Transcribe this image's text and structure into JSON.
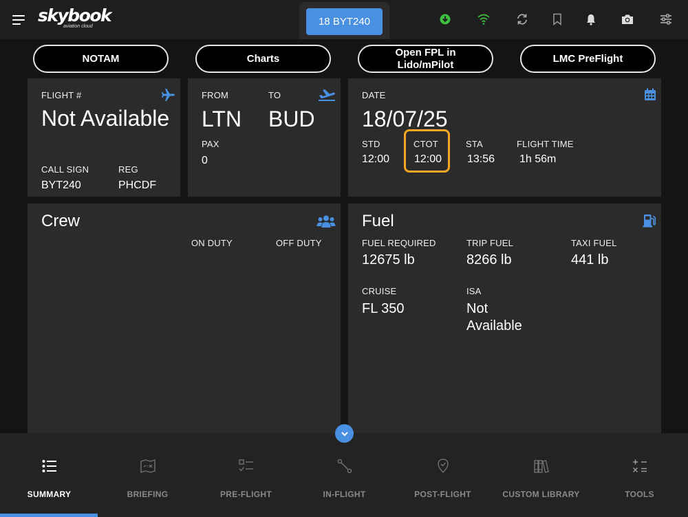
{
  "app": {
    "logo": "skybook",
    "logo_sub": "aviation cloud"
  },
  "header": {
    "flight_button": "18 BYT240",
    "icons": [
      "download-icon",
      "wifi-icon",
      "sync-icon",
      "bookmark-icon",
      "bell-icon",
      "camera-icon",
      "settings-sliders-icon"
    ]
  },
  "actions": {
    "notam": "NOTAM",
    "charts": "Charts",
    "open_fpl": "Open FPL in Lido/mPilot",
    "lmc": "LMC PreFlight"
  },
  "flight": {
    "label": "FLIGHT #",
    "value": "Not Available",
    "callsign_label": "CALL SIGN",
    "callsign": "BYT240",
    "reg_label": "REG",
    "reg": "PHCDF"
  },
  "route": {
    "from_label": "FROM",
    "from": "LTN",
    "to_label": "TO",
    "to": "BUD",
    "pax_label": "PAX",
    "pax": "0"
  },
  "schedule": {
    "date_label": "DATE",
    "date": "18/07/25",
    "std_label": "STD",
    "std": "12:00",
    "ctot_label": "CTOT",
    "ctot": "12:00",
    "sta_label": "STA",
    "sta": "13:56",
    "flight_time_label": "FLIGHT TIME",
    "flight_time": "1h 56m"
  },
  "crew": {
    "title": "Crew",
    "on_duty_label": "ON DUTY",
    "off_duty_label": "OFF DUTY"
  },
  "fuel": {
    "title": "Fuel",
    "required_label": "FUEL REQUIRED",
    "required": "12675 lb",
    "trip_label": "TRIP FUEL",
    "trip": "8266 lb",
    "taxi_label": "TAXI FUEL",
    "taxi": "441 lb",
    "cruise_label": "CRUISE",
    "cruise": "FL 350",
    "isa_label": "ISA",
    "isa": "Not Available"
  },
  "nav": {
    "summary": "SUMMARY",
    "briefing": "BRIEFING",
    "preflight": "PRE-FLIGHT",
    "inflight": "IN-FLIGHT",
    "postflight": "POST-FLIGHT",
    "library": "CUSTOM LIBRARY",
    "tools": "TOOLS"
  },
  "colors": {
    "accent": "#4a90e2",
    "highlight": "#f5a623",
    "panel": "#2b2b2b",
    "status_green": "#3fbf3f"
  }
}
